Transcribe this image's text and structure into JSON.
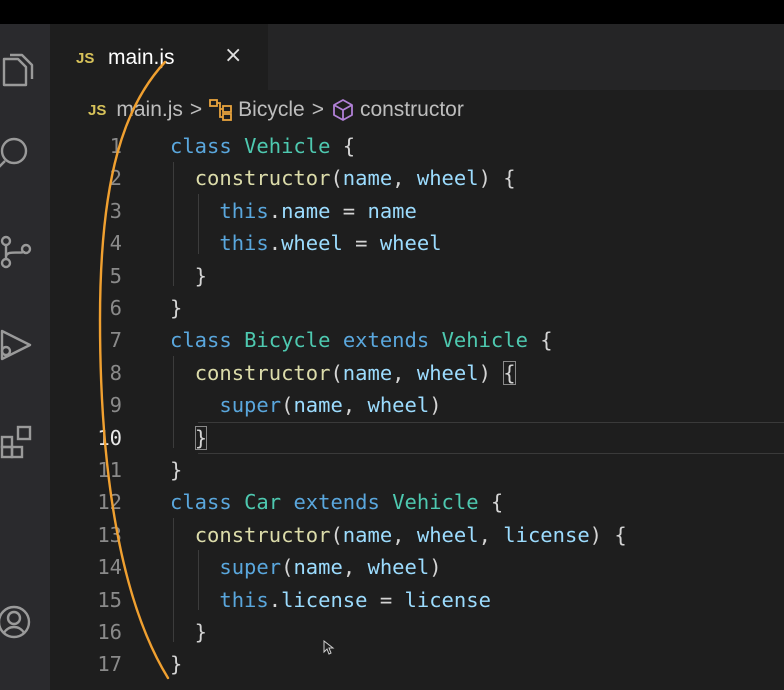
{
  "tab": {
    "badge": "JS",
    "filename": "main.js",
    "close_glyph": "×"
  },
  "breadcrumb": {
    "badge": "JS",
    "items": [
      "main.js",
      "Bicycle",
      "constructor"
    ],
    "separator": ">"
  },
  "activity_bar": {
    "icons": [
      "files-icon",
      "search-icon",
      "source-control-icon",
      "run-debug-icon",
      "extensions-icon",
      "account-icon"
    ]
  },
  "editor": {
    "active_line": 10,
    "lines": [
      {
        "n": "1",
        "tokens": [
          [
            "kw",
            "class"
          ],
          [
            "pn",
            " "
          ],
          [
            "cls",
            "Vehicle"
          ],
          [
            "pn",
            " {"
          ]
        ]
      },
      {
        "n": "2",
        "tokens": [
          [
            "pn",
            "  "
          ],
          [
            "fn",
            "constructor"
          ],
          [
            "pn",
            "("
          ],
          [
            "pm",
            "name"
          ],
          [
            "pn",
            ", "
          ],
          [
            "pm",
            "wheel"
          ],
          [
            "pn",
            ") {"
          ]
        ]
      },
      {
        "n": "3",
        "tokens": [
          [
            "pn",
            "    "
          ],
          [
            "kw",
            "this"
          ],
          [
            "pn",
            "."
          ],
          [
            "pm",
            "name"
          ],
          [
            "pn",
            " = "
          ],
          [
            "pm",
            "name"
          ]
        ]
      },
      {
        "n": "4",
        "tokens": [
          [
            "pn",
            "    "
          ],
          [
            "kw",
            "this"
          ],
          [
            "pn",
            "."
          ],
          [
            "pm",
            "wheel"
          ],
          [
            "pn",
            " = "
          ],
          [
            "pm",
            "wheel"
          ]
        ]
      },
      {
        "n": "5",
        "tokens": [
          [
            "pn",
            "  }"
          ]
        ]
      },
      {
        "n": "6",
        "tokens": [
          [
            "pn",
            "}"
          ]
        ]
      },
      {
        "n": "7",
        "tokens": [
          [
            "kw",
            "class"
          ],
          [
            "pn",
            " "
          ],
          [
            "cls",
            "Bicycle"
          ],
          [
            "pn",
            " "
          ],
          [
            "kw",
            "extends"
          ],
          [
            "pn",
            " "
          ],
          [
            "cls",
            "Vehicle"
          ],
          [
            "pn",
            " {"
          ]
        ]
      },
      {
        "n": "8",
        "tokens": [
          [
            "pn",
            "  "
          ],
          [
            "fn",
            "constructor"
          ],
          [
            "pn",
            "("
          ],
          [
            "pm",
            "name"
          ],
          [
            "pn",
            ", "
          ],
          [
            "pm",
            "wheel"
          ],
          [
            "pn",
            ") "
          ],
          [
            "box",
            "{"
          ]
        ]
      },
      {
        "n": "9",
        "tokens": [
          [
            "pn",
            "    "
          ],
          [
            "kw",
            "super"
          ],
          [
            "pn",
            "("
          ],
          [
            "pm",
            "name"
          ],
          [
            "pn",
            ", "
          ],
          [
            "pm",
            "wheel"
          ],
          [
            "pn",
            ")"
          ]
        ]
      },
      {
        "n": "10",
        "tokens": [
          [
            "pn",
            "  "
          ],
          [
            "box",
            "}"
          ]
        ]
      },
      {
        "n": "11",
        "tokens": [
          [
            "pn",
            "}"
          ]
        ]
      },
      {
        "n": "12",
        "tokens": [
          [
            "kw",
            "class"
          ],
          [
            "pn",
            " "
          ],
          [
            "cls",
            "Car"
          ],
          [
            "pn",
            " "
          ],
          [
            "kw",
            "extends"
          ],
          [
            "pn",
            " "
          ],
          [
            "cls",
            "Vehicle"
          ],
          [
            "pn",
            " {"
          ]
        ]
      },
      {
        "n": "13",
        "tokens": [
          [
            "pn",
            "  "
          ],
          [
            "fn",
            "constructor"
          ],
          [
            "pn",
            "("
          ],
          [
            "pm",
            "name"
          ],
          [
            "pn",
            ", "
          ],
          [
            "pm",
            "wheel"
          ],
          [
            "pn",
            ", "
          ],
          [
            "pm",
            "license"
          ],
          [
            "pn",
            ") {"
          ]
        ]
      },
      {
        "n": "14",
        "tokens": [
          [
            "pn",
            "    "
          ],
          [
            "kw",
            "super"
          ],
          [
            "pn",
            "("
          ],
          [
            "pm",
            "name"
          ],
          [
            "pn",
            ", "
          ],
          [
            "pm",
            "wheel"
          ],
          [
            "pn",
            ")"
          ]
        ]
      },
      {
        "n": "15",
        "tokens": [
          [
            "pn",
            "    "
          ],
          [
            "kw",
            "this"
          ],
          [
            "pn",
            "."
          ],
          [
            "pm",
            "license"
          ],
          [
            "pn",
            " = "
          ],
          [
            "pm",
            "license"
          ]
        ]
      },
      {
        "n": "16",
        "tokens": [
          [
            "pn",
            "  }"
          ]
        ]
      },
      {
        "n": "17",
        "tokens": [
          [
            "pn",
            "}"
          ]
        ]
      }
    ]
  },
  "colors": {
    "keyword": "#5aa7dd",
    "class": "#4ec9b0",
    "function": "#dcdcaa",
    "param": "#9cdcfe",
    "punct": "#d4d4d4",
    "annotation": "#f0a030",
    "js_badge": "#d7c25a"
  }
}
